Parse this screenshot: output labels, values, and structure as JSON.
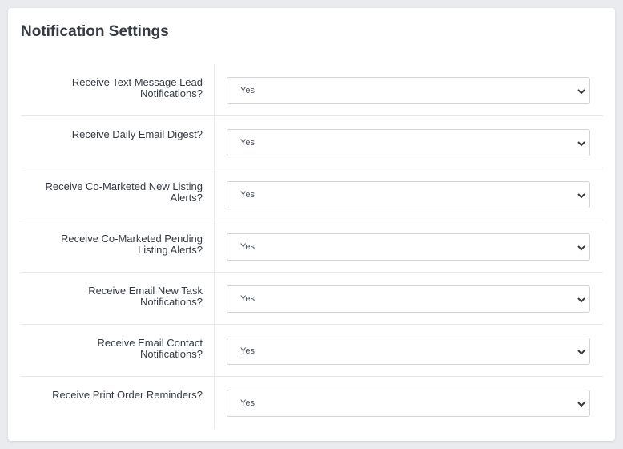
{
  "card": {
    "title": "Notification Settings"
  },
  "settings": [
    {
      "label": "Receive Text Message Lead Notifications?",
      "value": "Yes"
    },
    {
      "label": "Receive Daily Email Digest?",
      "value": "Yes"
    },
    {
      "label": "Receive Co-Marketed New Listing Alerts?",
      "value": "Yes"
    },
    {
      "label": "Receive Co-Marketed Pending Listing Alerts?",
      "value": "Yes"
    },
    {
      "label": "Receive Email New Task Notifications?",
      "value": "Yes"
    },
    {
      "label": "Receive Email Contact Notifications?",
      "value": "Yes"
    },
    {
      "label": "Receive Print Order Reminders?",
      "value": "Yes"
    }
  ],
  "icons": {
    "select_indicator": "chevron-down-icon"
  }
}
